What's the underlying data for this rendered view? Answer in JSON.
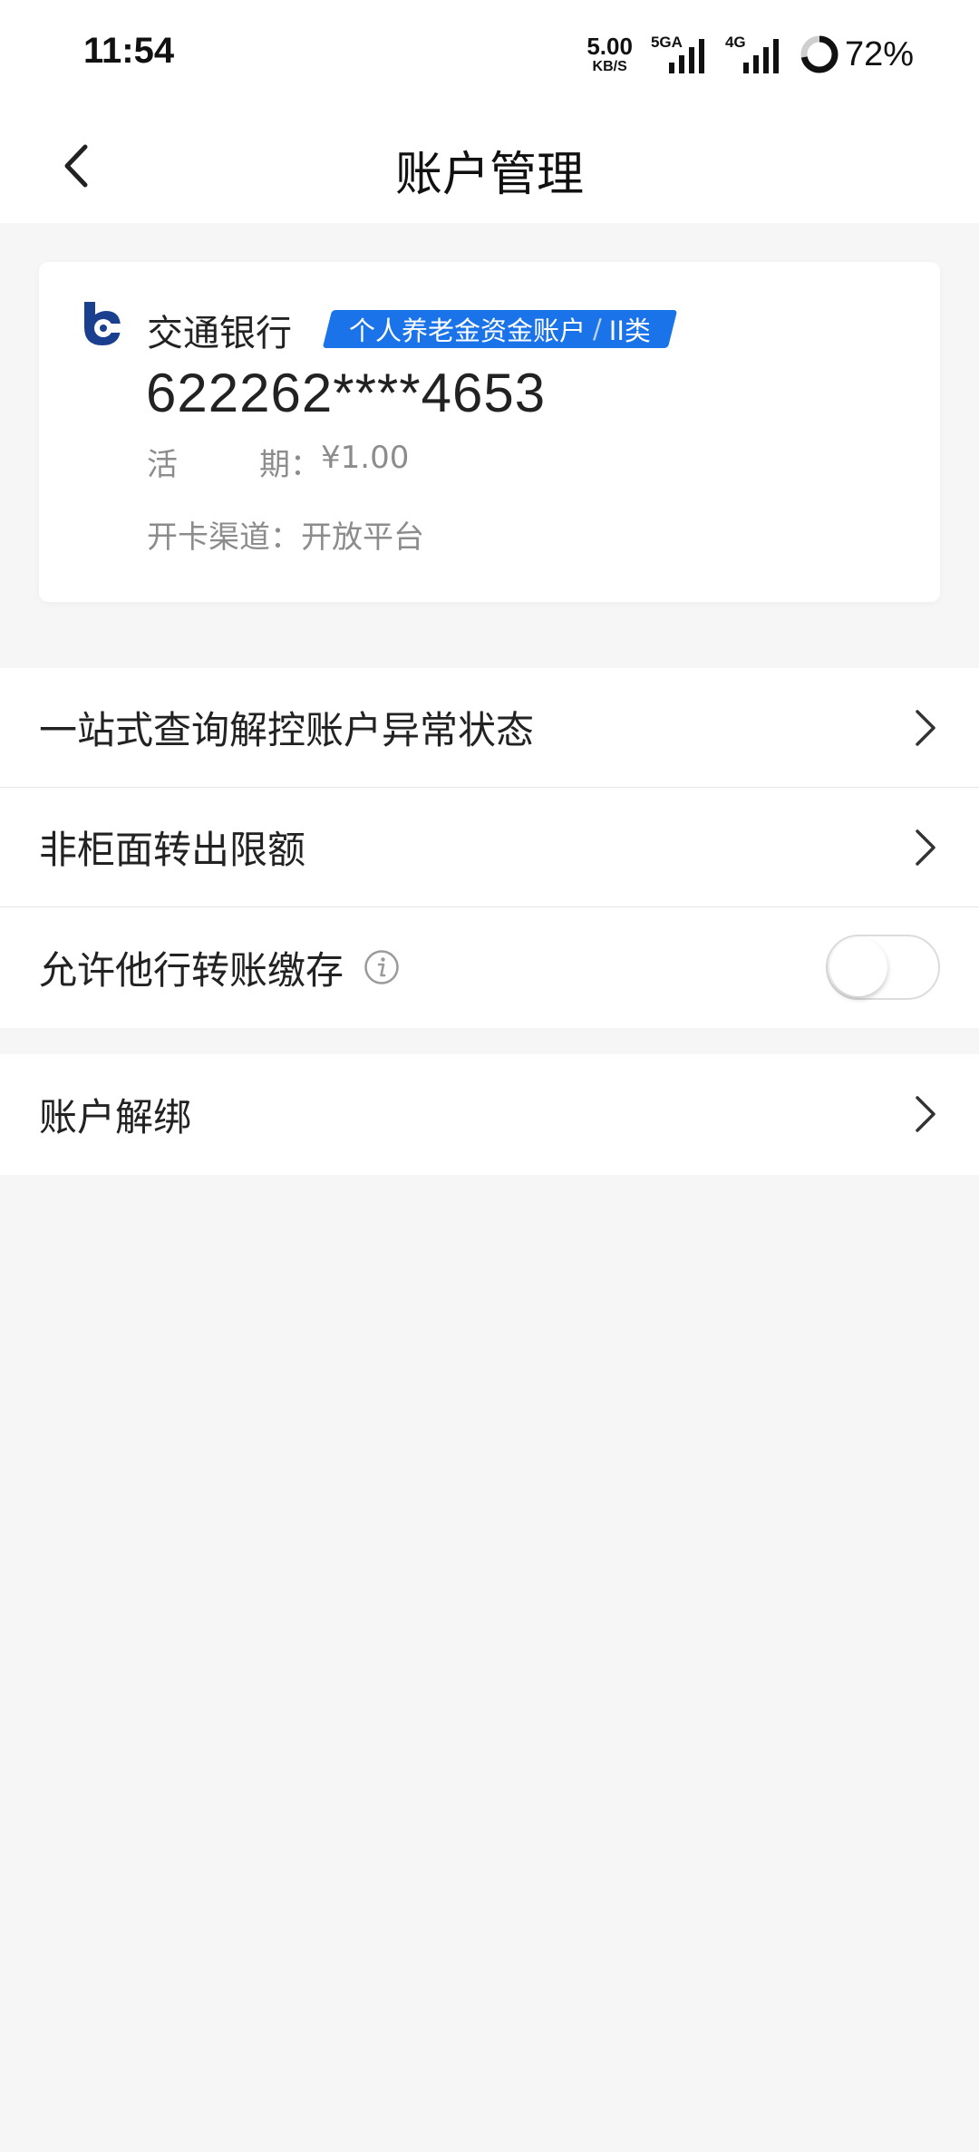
{
  "status_bar": {
    "time": "11:54",
    "net_speed_value": "5.00",
    "net_speed_unit": "KB/S",
    "signal_1_label": "5GA",
    "signal_2_label": "4G",
    "battery_percent": "72%"
  },
  "nav": {
    "title": "账户管理"
  },
  "card": {
    "bank_name": "交通银行",
    "account_type": "个人养老金资金账户",
    "account_class": "II类",
    "card_number": "622262****4653",
    "balance_label_a": "活",
    "balance_label_b": "期：",
    "balance_value": "¥1.00",
    "channel_label": "开卡渠道：",
    "channel_value": "开放平台"
  },
  "menu": {
    "items": [
      {
        "label": "一站式查询解控账户异常状态"
      },
      {
        "label": "非柜面转出限额"
      },
      {
        "label": "允许他行转账缴存",
        "toggle_on": false
      }
    ],
    "unbind_label": "账户解绑"
  },
  "colors": {
    "accent": "#1a73e8",
    "brand_logo": "#1b3f8f",
    "background": "#f6f6f7"
  }
}
